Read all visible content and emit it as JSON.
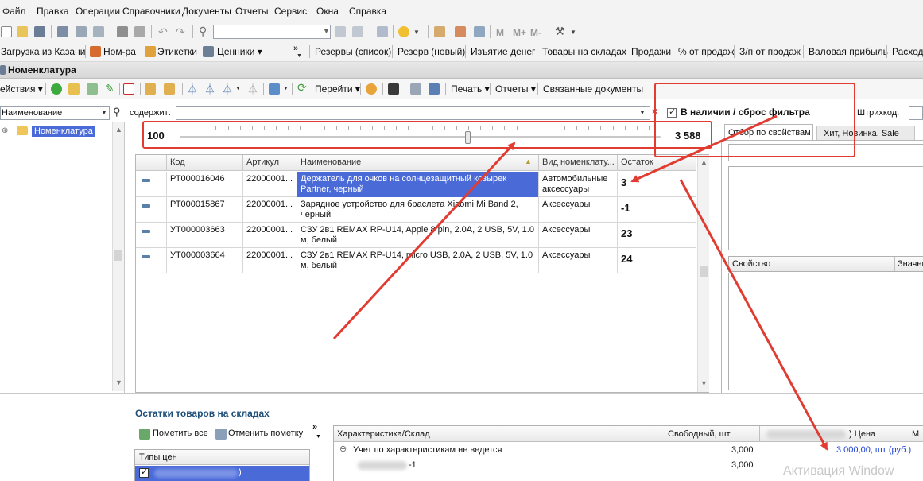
{
  "menu": [
    "Файл",
    "Правка",
    "Операции",
    "Справочники",
    "Документы",
    "Отчеты",
    "Сервис",
    "Окна",
    "Справка"
  ],
  "toolbar1": {
    "m_buttons": [
      "M",
      "M+",
      "M-"
    ]
  },
  "toolbar2": {
    "left_items": [
      "Загрузка из Казани",
      "Ном-ра",
      "Этикетки",
      "Ценники ▾"
    ],
    "right_items": [
      "Резервы (список)",
      "Резерв (новый)",
      "Изъятие денег",
      "Товары на складах",
      "Продажи",
      "% от продаж",
      "З/п от продаж",
      "Валовая прибыль",
      "Расход"
    ]
  },
  "window_title": "Номенклатура",
  "toolbar3": {
    "actions_label": "ействия ▾",
    "goto_label": "Перейти ▾",
    "print_label": "Печать ▾",
    "reports_label": "Отчеты ▾",
    "linked_docs_label": "Связанные документы"
  },
  "filter": {
    "field_select": "Наименование",
    "contains_label": "содержит:",
    "contains_value": "",
    "in_stock_label": "В наличии / сброс фильтра",
    "in_stock_checked": true,
    "barcode_label": "Штрихкод:"
  },
  "slider": {
    "min": "100",
    "max": "3 588",
    "position": 0.6
  },
  "tree": {
    "root_label": "Номенклатура"
  },
  "grid": {
    "headers": [
      "Код",
      "Артикул",
      "Наименование",
      "Вид номенклату...",
      "Остаток"
    ],
    "rows": [
      {
        "code": "РТ000016046",
        "article": "22000001...",
        "name": "Держатель для очков на солнцезащитный козырек Partner, черный",
        "kind": "Автомобильные аксессуары",
        "stock": "3",
        "selected": true
      },
      {
        "code": "РТ000015867",
        "article": "22000001...",
        "name": "Зарядное устройство для браслета Xiaomi Mi Band 2, черный",
        "kind": "Аксессуары",
        "stock": "-1",
        "selected": false
      },
      {
        "code": "УТ000003663",
        "article": "22000001...",
        "name": "СЗУ 2в1 REMAX RP-U14, Apple 8 pin, 2.0A, 2 USB, 5V, 1.0 м, белый",
        "kind": "Аксессуары",
        "stock": "23",
        "selected": false
      },
      {
        "code": "УТ000003664",
        "article": "22000001...",
        "name": "СЗУ 2в1 REMAX RP-U14, micro USB, 2.0A, 2 USB, 5V, 1.0 м, белый",
        "kind": "Аксессуары",
        "stock": "24",
        "selected": false
      }
    ]
  },
  "right_panel": {
    "tabs": [
      "Отбор по свойствам",
      "Хит, Новинка, Sale"
    ],
    "prop_headers": [
      "Свойство",
      "Значен"
    ]
  },
  "bottom": {
    "section_title": "Остатки товаров на складах",
    "mark_all": "Пометить все",
    "unmark": "Отменить пометку",
    "price_types_header": "Типы цен",
    "price_type_row": ")",
    "stock_headers": [
      "Характеристика/Склад",
      "Свободный, шт",
      ") Цена",
      "М"
    ],
    "stock_rows": [
      {
        "label": "Учет по характеристикам не ведется",
        "free": "3,000",
        "price": "3 000,00, шт (руб.)"
      },
      {
        "label": "-1",
        "free": "3,000",
        "price": ""
      }
    ]
  },
  "watermark": "Активация Window",
  "colors": {
    "annotation": "#e03c31",
    "selected_row": "#4a6ad8",
    "price_link": "#1a3fd6",
    "section_title": "#1e4f7a"
  }
}
